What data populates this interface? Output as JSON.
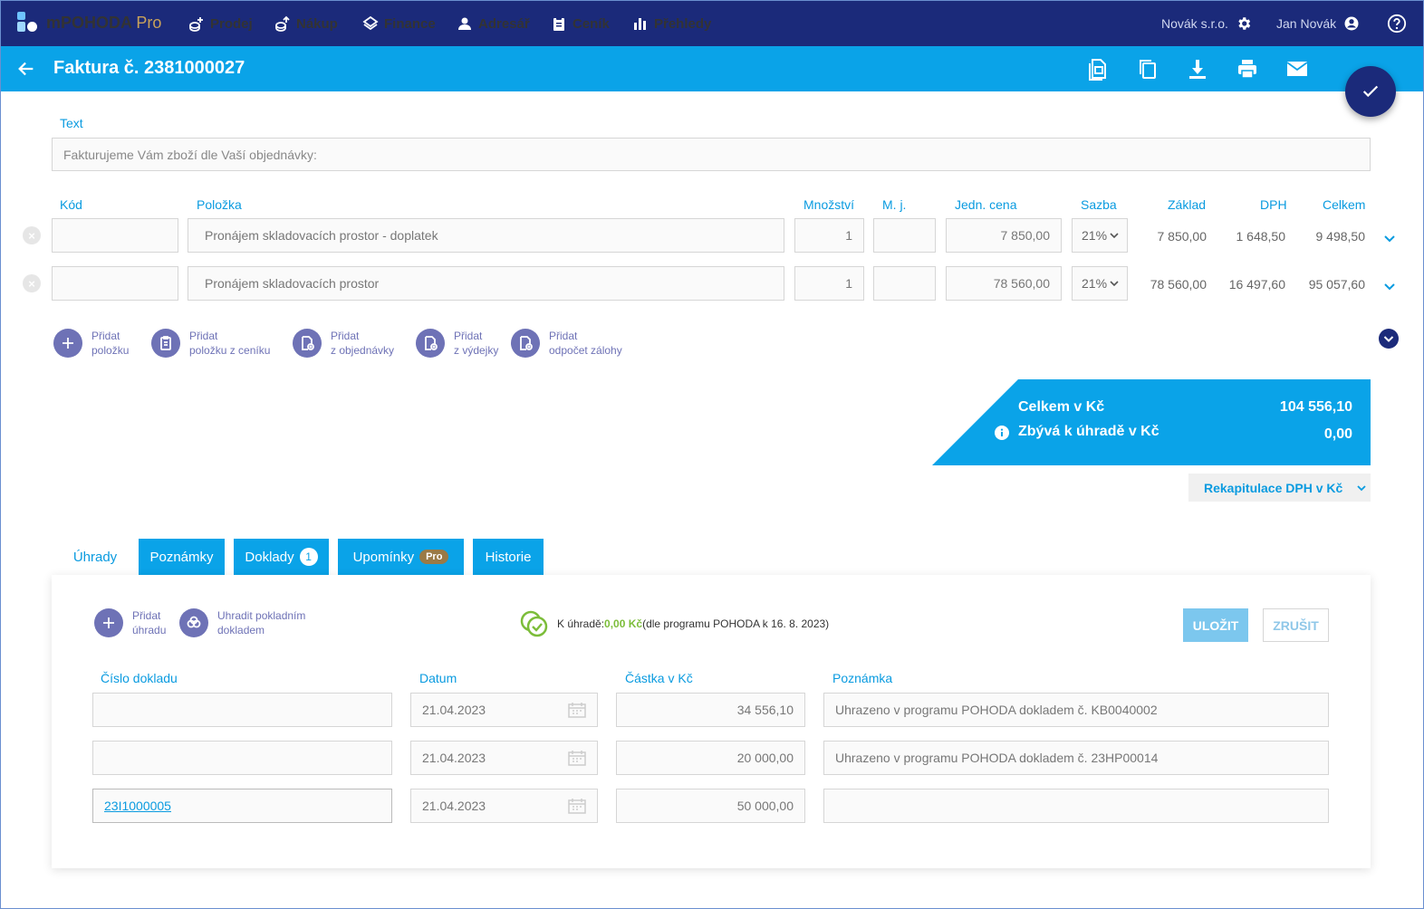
{
  "brand": {
    "name": "mPOHODA",
    "tier": "Pro"
  },
  "nav": [
    {
      "label": "Prodej",
      "icon": "sales-icon"
    },
    {
      "label": "Nákup",
      "icon": "purchase-icon"
    },
    {
      "label": "Finance",
      "icon": "finance-icon"
    },
    {
      "label": "Adresář",
      "icon": "person-icon"
    },
    {
      "label": "Ceník",
      "icon": "clipboard-icon"
    },
    {
      "label": "Přehledy",
      "icon": "bar-chart-icon"
    }
  ],
  "account": {
    "company": "Novák s.r.o.",
    "user": "Jan Novák"
  },
  "header": {
    "title": "Faktura č. 2381000027"
  },
  "text_section": {
    "label": "Text",
    "value": "Fakturujeme Vám zboží dle Vaší objednávky:"
  },
  "items_table": {
    "headers": {
      "code": "Kód",
      "item": "Položka",
      "qty": "Množství",
      "unit": "M. j.",
      "unit_price": "Jedn. cena",
      "rate": "Sazba",
      "base": "Základ",
      "vat": "DPH",
      "total": "Celkem"
    },
    "rows": [
      {
        "code": "",
        "item": "Pronájem skladovacích prostor - doplatek",
        "qty": "1",
        "unit": "",
        "unit_price": "7 850,00",
        "rate": "21%",
        "base": "7 850,00",
        "vat": "1 648,50",
        "total": "9 498,50"
      },
      {
        "code": "",
        "item": "Pronájem skladovacích prostor",
        "qty": "1",
        "unit": "",
        "unit_price": "78 560,00",
        "rate": "21%",
        "base": "78 560,00",
        "vat": "16 497,60",
        "total": "95 057,60"
      }
    ]
  },
  "add_actions": [
    {
      "line1": "Přidat",
      "line2": "položku"
    },
    {
      "line1": "Přidat",
      "line2": "položku z ceníku"
    },
    {
      "line1": "Přidat",
      "line2": "z objednávky"
    },
    {
      "line1": "Přidat",
      "line2": "z výdejky"
    },
    {
      "line1": "Přidat",
      "line2": "odpočet zálohy"
    }
  ],
  "totals": {
    "total_label": "Celkem v Kč",
    "total_value": "104 556,10",
    "remaining_label": "Zbývá k úhradě v Kč",
    "remaining_value": "0,00",
    "vat_recap": "Rekapitulace DPH v Kč"
  },
  "tabs": [
    {
      "label": "Úhrady"
    },
    {
      "label": "Poznámky"
    },
    {
      "label": "Doklady",
      "badge": "1"
    },
    {
      "label": "Upomínky",
      "badge": "Pro"
    },
    {
      "label": "Historie"
    }
  ],
  "payments": {
    "actions": [
      {
        "line1": "Přidat",
        "line2": "úhradu"
      },
      {
        "line1": "Uhradit pokladním",
        "line2": "dokladem"
      }
    ],
    "due_label": "K úhradě:",
    "due_value": "0,00 Kč",
    "due_note": "(dle programu POHODA k 16. 8. 2023)",
    "save": "ULOŽIT",
    "cancel": "ZRUŠIT",
    "headers": {
      "doc": "Číslo dokladu",
      "date": "Datum",
      "amount": "Částka v Kč",
      "note": "Poznámka"
    },
    "rows": [
      {
        "doc": "",
        "date": "21.04.2023",
        "amount": "34 556,10",
        "note": "Uhrazeno v programu POHODA dokladem č. KB0040002"
      },
      {
        "doc": "",
        "date": "21.04.2023",
        "amount": "20 000,00",
        "note": "Uhrazeno v programu POHODA dokladem č. 23HP00014"
      },
      {
        "doc": "23I1000005",
        "date": "21.04.2023",
        "amount": "50 000,00",
        "note": ""
      }
    ]
  },
  "colors": {
    "navy": "#1b2a7a",
    "blue": "#0aa3e8",
    "purple": "#6e72b6",
    "green": "#7cbd3a",
    "gold": "#c9a25a"
  }
}
